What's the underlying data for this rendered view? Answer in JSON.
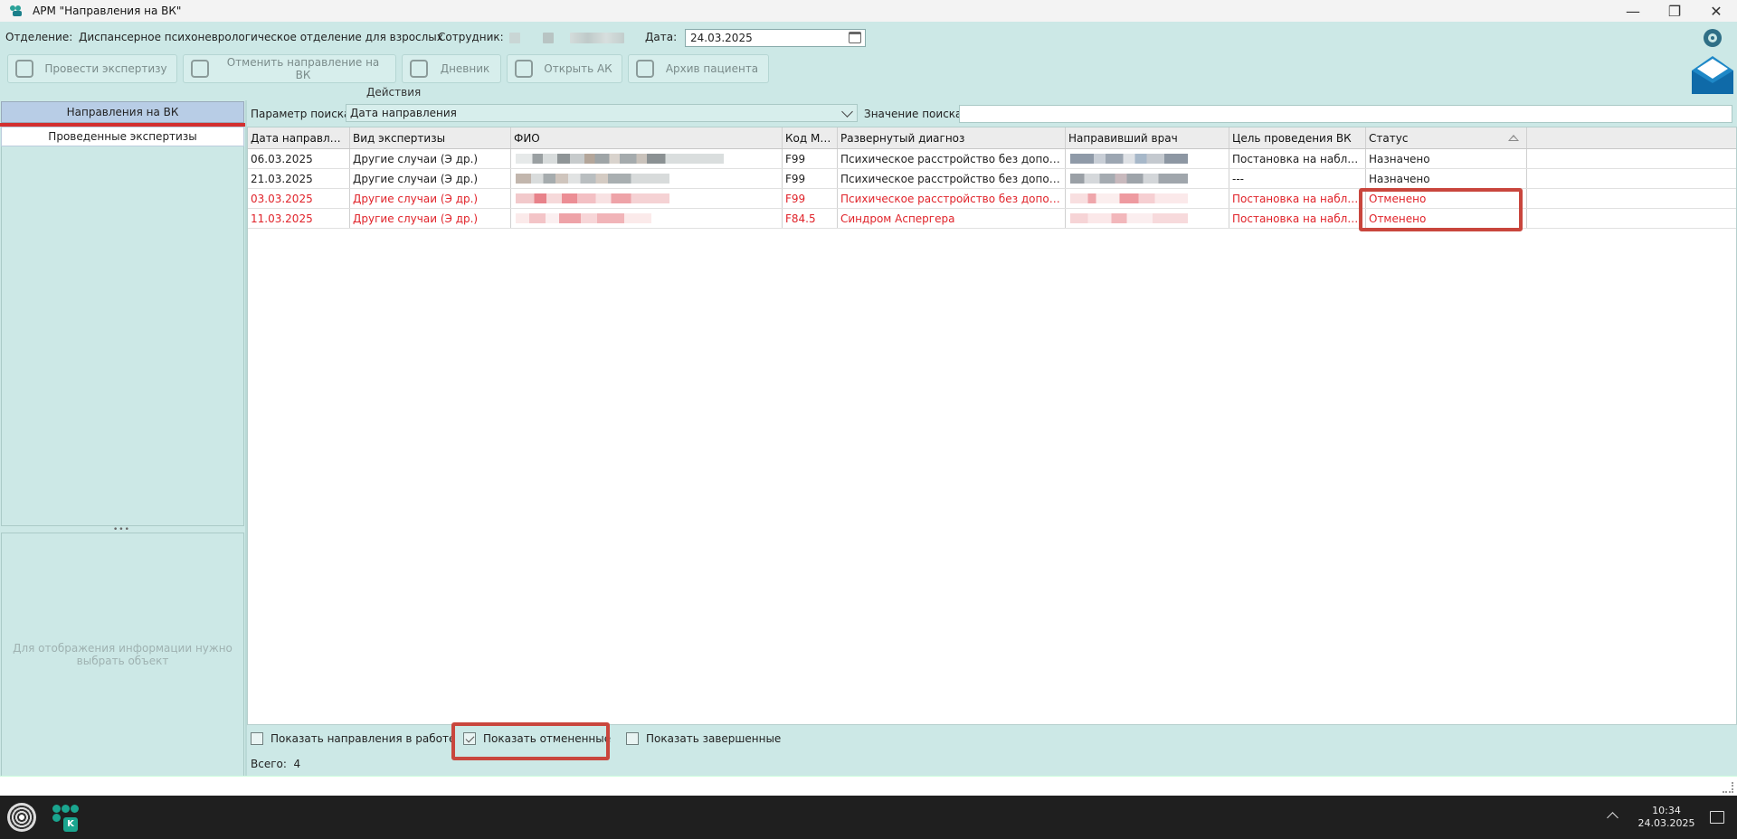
{
  "window": {
    "title": "АРМ \"Направления на ВК\""
  },
  "info": {
    "department_label": "Отделение:",
    "department_value": "Диспансерное психоневрологическое отделение для взрослых",
    "employee_label": "Сотрудник:",
    "date_label": "Дата:",
    "date_value": "24.03.2025"
  },
  "toolbar": {
    "buttons": [
      {
        "label": "Провести экспертизу",
        "icon": "expert-icon"
      },
      {
        "label": "Отменить направление на ВК",
        "icon": "cancel-referral-icon"
      },
      {
        "label": "Дневник",
        "icon": "diary-icon"
      },
      {
        "label": "Открыть АК",
        "icon": "open-card-icon"
      },
      {
        "label": "Архив пациента",
        "icon": "archive-icon"
      }
    ],
    "group_label": "Действия"
  },
  "left": {
    "tab_active": "Направления на ВК",
    "tab_inactive": "Проведенные экспертизы",
    "placeholder": "Для отображения информации нужно выбрать объект"
  },
  "search": {
    "param_label": "Параметр поиска",
    "param_value": "Дата направления",
    "value_label": "Значение поиска",
    "value": ""
  },
  "table": {
    "columns": [
      "Дата направления",
      "Вид экспертизы",
      "ФИО",
      "Код МКБ",
      "Развернутый диагноз",
      "Направивший врач",
      "Цель проведения ВК",
      "Статус"
    ],
    "rows": [
      {
        "date": "06.03.2025",
        "type": "Другие случаи (Э др.)",
        "mkb": "F99",
        "diagnosis": "Психическое расстройство без дополнительных уточнений",
        "goal": "Постановка на наблюдение",
        "status": "Назначено",
        "cancelled": false
      },
      {
        "date": "21.03.2025",
        "type": "Другие случаи (Э др.)",
        "mkb": "F99",
        "diagnosis": "Психическое расстройство без дополнительных уточнений",
        "goal": "---",
        "status": "Назначено",
        "cancelled": false
      },
      {
        "date": "03.03.2025",
        "type": "Другие случаи (Э др.)",
        "mkb": "F99",
        "diagnosis": "Психическое расстройство без дополнительных уточнений",
        "goal": "Постановка на наблюдение",
        "status": "Отменено",
        "cancelled": true
      },
      {
        "date": "11.03.2025",
        "type": "Другие случаи (Э др.)",
        "mkb": "F84.5",
        "diagnosis": "Синдром Аспергера",
        "goal": "Постановка на наблюдение",
        "status": "Отменено",
        "cancelled": true
      }
    ]
  },
  "filters": {
    "in_work_label": "Показать направления в работе",
    "in_work_checked": false,
    "cancelled_label": "Показать отмененные",
    "cancelled_checked": true,
    "completed_label": "Показать завершенные",
    "completed_checked": false
  },
  "footer": {
    "total_label": "Всего:",
    "total_value": "4"
  },
  "taskbar": {
    "time": "10:34",
    "date": "24.03.2025"
  },
  "colors": {
    "background": "#cce8e6",
    "cancelled_text": "#e0232a",
    "highlight": "#c9463d",
    "active_tab": "#b8cde6"
  }
}
